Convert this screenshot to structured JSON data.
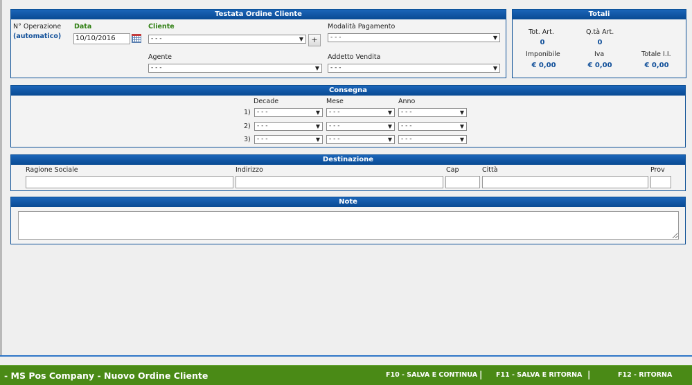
{
  "testata": {
    "title": "Testata Ordine Cliente",
    "n_operazione_label": "N° Operazione",
    "n_operazione_value": "(automatico)",
    "data_label": "Data",
    "data_value": "10/10/2016",
    "cliente_label": "Cliente",
    "cliente_value": "- - -",
    "add_cliente_label": "+",
    "agente_label": "Agente",
    "agente_value": "- - -",
    "pagamento_label": "Modalità Pagamento",
    "pagamento_value": "- - -",
    "addetto_label": "Addetto Vendita",
    "addetto_value": "- - -"
  },
  "totali": {
    "title": "Totali",
    "tot_art_label": "Tot. Art.",
    "tot_art_value": "0",
    "qta_art_label": "Q.tà Art.",
    "qta_art_value": "0",
    "imponibile_label": "Imponibile",
    "imponibile_value": "€ 0,00",
    "iva_label": "Iva",
    "iva_value": "€ 0,00",
    "totale_label": "Totale I.I.",
    "totale_value": "€ 0,00"
  },
  "consegna": {
    "title": "Consegna",
    "decade_label": "Decade",
    "mese_label": "Mese",
    "anno_label": "Anno",
    "rows": [
      {
        "num": "1)",
        "decade": "- - -",
        "mese": "- - -",
        "anno": "- - -"
      },
      {
        "num": "2)",
        "decade": "- - -",
        "mese": "- - -",
        "anno": "- - -"
      },
      {
        "num": "3)",
        "decade": "- - -",
        "mese": "- - -",
        "anno": "- - -"
      }
    ]
  },
  "destinazione": {
    "title": "Destinazione",
    "ragione_label": "Ragione Sociale",
    "indirizzo_label": "Indirizzo",
    "cap_label": "Cap",
    "citta_label": "Città",
    "prov_label": "Prov"
  },
  "note": {
    "title": "Note"
  },
  "footer": {
    "title": "- MS Pos Company - Nuovo Ordine Cliente",
    "f10": "F10 - SALVA E CONTINUA",
    "f11": "F11 - SALVA E RITORNA",
    "f12": "F12 - RITORNA",
    "sep": "|"
  },
  "colors": {
    "header_blue": "#094a93",
    "label_green": "#2f7f12",
    "value_blue": "#104f99",
    "footer_green": "#4a8a16"
  }
}
